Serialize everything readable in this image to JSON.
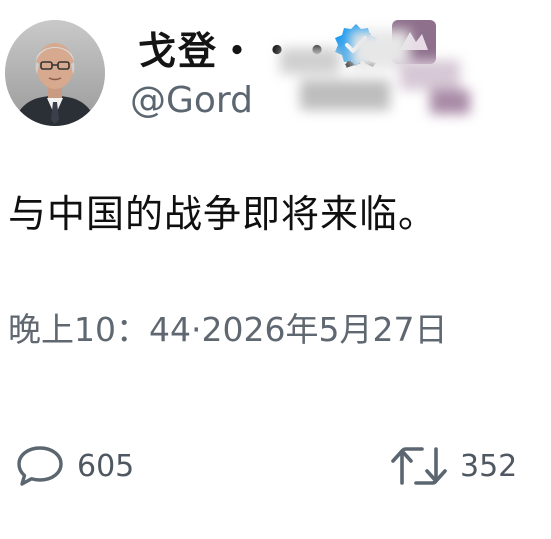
{
  "author": {
    "display_name": "戈登・・・长",
    "handle": "@Gord"
  },
  "tweet": {
    "text": "与中国的战争即将来临。",
    "timestamp": "晚上10：44·2026年5月27日"
  },
  "actions": {
    "reply_count": "605",
    "retweet_count": "352"
  },
  "colors": {
    "text": "#111111",
    "muted": "#5b6670",
    "verified": "#1d9bf0"
  }
}
